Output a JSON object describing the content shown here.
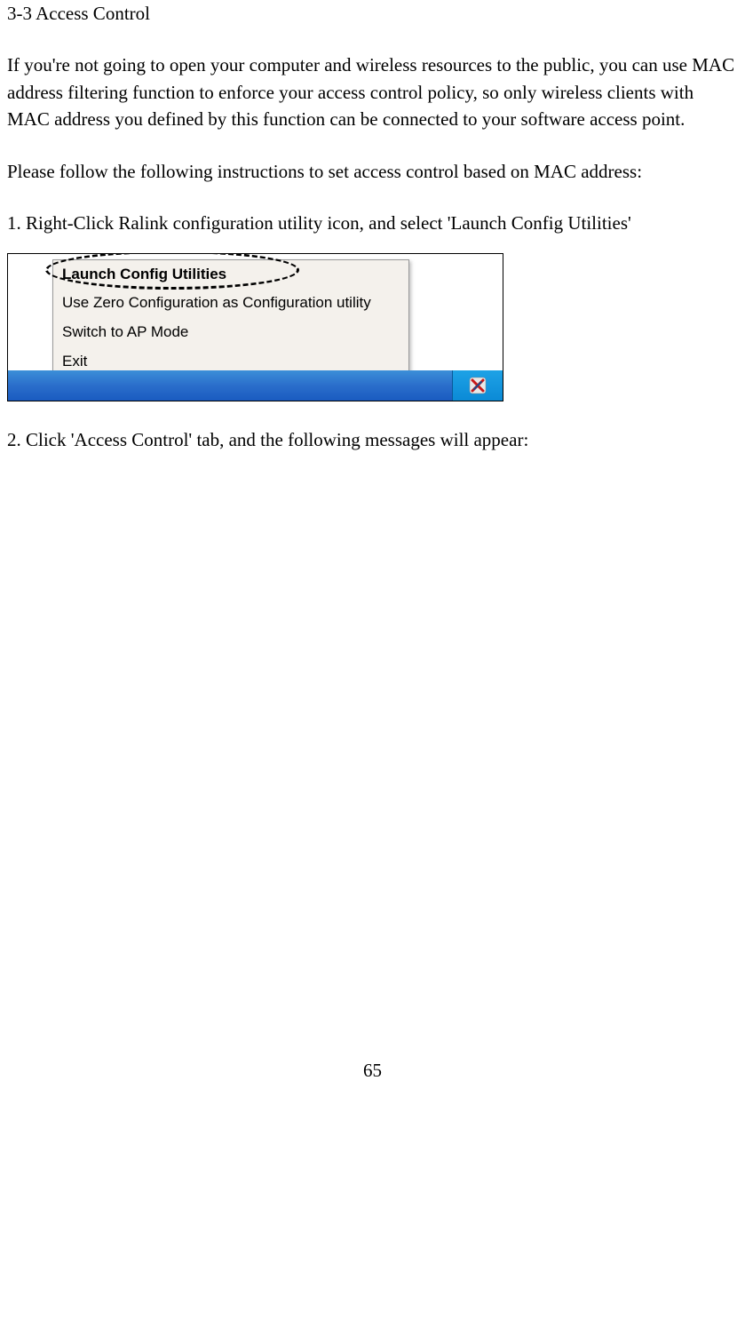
{
  "section_title": "3-3 Access Control",
  "intro_para": "If you're not going to open your computer and wireless resources to the public, you can use MAC address filtering function to enforce your access control policy, so only wireless clients with MAC address you defined by this function can be connected to your software access point.",
  "follow_para": "Please follow the following instructions to set access control based on MAC address:",
  "step1": "1. Right-Click Ralink configuration utility icon, and select 'Launch Config Utilities'",
  "step2": "2. Click 'Access Control' tab, and the following messages will appear:",
  "menu": {
    "items": [
      "Launch Config Utilities",
      "Use Zero Configuration as Configuration utility",
      "Switch to AP Mode",
      "Exit"
    ]
  },
  "page_number": "65"
}
